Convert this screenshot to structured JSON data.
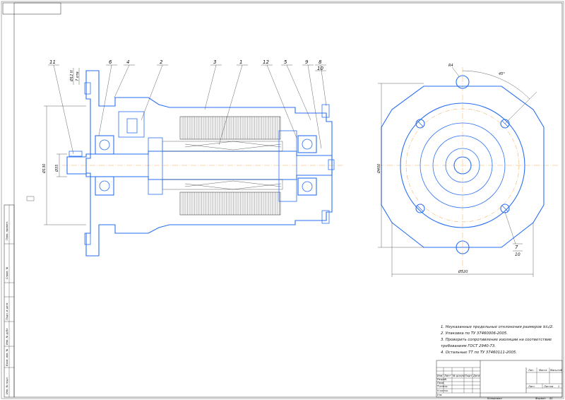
{
  "drawing": {
    "leaders": [
      "11",
      "6",
      "4",
      "2",
      "3",
      "1",
      "12",
      "5",
      "9",
      "8",
      "10"
    ],
    "leader_7": "7",
    "leader_7_sub": "10",
    "dims": {
      "shaft_top1": "Ø12 Н",
      "shaft_top2": "7 отв",
      "d_left1": "Ø130",
      "d_left2": "Ø35",
      "d_front": "Ø400",
      "w_front": "Ø520",
      "hole_r": "R4",
      "angle": "45°"
    }
  },
  "notes": [
    "1. Неуказанные предельные отклонения размеров ±t₂/2.",
    "2. Упаковка по ТУ 37460006-2005.",
    "3. Проверить сопротивление изоляции на соответствие",
    "   требованиям ГОСТ 2940-73.",
    "4. Остальные ТТ по ТУ 37460111-2005."
  ],
  "title_block": {
    "h1": "Изм.",
    "h2": "Лист",
    "h3": "№ докум.",
    "h4": "Подп.",
    "h5": "Дата",
    "r1": "Разраб.",
    "r2": "Пров.",
    "r3": "Т.контр.",
    "r4": "Н.контр.",
    "r5": "Утв.",
    "lit": "Лит.",
    "mass": "Масса",
    "scale": "Масштаб",
    "sheet": "Лист",
    "sheets": "Листов",
    "sheets_n": "1",
    "copied": "Копировал",
    "format": "Формат",
    "format_v": "А1"
  },
  "side_strip": [
    "Перв. примен.",
    "Справ. №",
    "Подп. и дата",
    "Инв. № дубл.",
    "Взам. инв. №",
    "Подп. и дата",
    "Инв. № подл."
  ]
}
